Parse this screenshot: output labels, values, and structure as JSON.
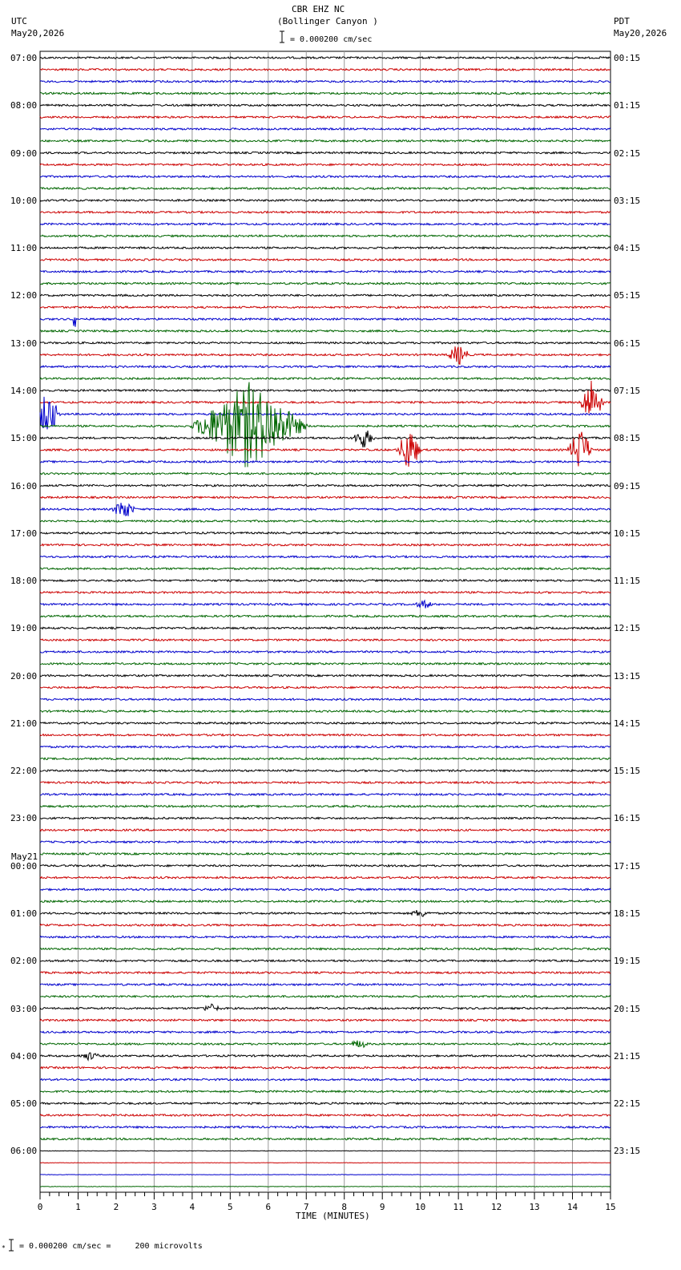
{
  "header": {
    "station_line": "CBR EHZ NC",
    "location_line": "(Bollinger Canyon )",
    "scale_text": "= 0.000200 cm/sec",
    "left_tz": "UTC",
    "left_date": "May20,2026",
    "right_tz": "PDT",
    "right_date": "May20,2026",
    "date_change_label": "May21"
  },
  "footer": {
    "scale_text": "= 0.000200 cm/sec =     200 microvolts"
  },
  "chart_data": {
    "type": "line",
    "xlabel": "TIME (MINUTES)",
    "xlim": [
      0,
      15
    ],
    "x_ticks": [
      "0",
      "1",
      "2",
      "3",
      "4",
      "5",
      "6",
      "7",
      "8",
      "9",
      "10",
      "11",
      "12",
      "13",
      "14",
      "15"
    ],
    "trace_colors": [
      "#000000",
      "#cc0000",
      "#0000cc",
      "#006600"
    ],
    "hour_labels_utc": [
      "07:00",
      "08:00",
      "09:00",
      "10:00",
      "11:00",
      "12:00",
      "13:00",
      "14:00",
      "15:00",
      "16:00",
      "17:00",
      "18:00",
      "19:00",
      "20:00",
      "21:00",
      "22:00",
      "23:00",
      "00:00",
      "01:00",
      "02:00",
      "03:00",
      "04:00",
      "05:00",
      "06:00"
    ],
    "hour_labels_pdt": [
      "00:15",
      "01:15",
      "02:15",
      "03:15",
      "04:15",
      "05:15",
      "06:15",
      "07:15",
      "08:15",
      "09:15",
      "10:15",
      "11:15",
      "12:15",
      "13:15",
      "14:15",
      "15:15",
      "16:15",
      "17:15",
      "18:15",
      "19:15",
      "20:15",
      "21:15",
      "22:15",
      "23:15"
    ],
    "traces_per_hour": 4,
    "events": [
      {
        "hour": "12:00",
        "trace": 2,
        "minute": 0.9,
        "amplitude": "large",
        "note": "spike"
      },
      {
        "hour": "13:00",
        "trace": 1,
        "minute": 11.0,
        "amplitude": "moderate"
      },
      {
        "hour": "14:00",
        "trace": 1,
        "minute": 14.5,
        "amplitude": "large"
      },
      {
        "hour": "14:00",
        "trace": 2,
        "minute": 0.2,
        "amplitude": "large"
      },
      {
        "hour": "14:00",
        "trace": 3,
        "minute": 5.5,
        "amplitude": "very large",
        "note": "earthquake"
      },
      {
        "hour": "15:00",
        "trace": 0,
        "minute": 8.5,
        "amplitude": "moderate"
      },
      {
        "hour": "15:00",
        "trace": 1,
        "minute": 14.2,
        "amplitude": "large"
      },
      {
        "hour": "15:00",
        "trace": 1,
        "minute": 9.7,
        "amplitude": "large"
      },
      {
        "hour": "16:00",
        "trace": 2,
        "minute": 2.2,
        "amplitude": "moderate"
      },
      {
        "hour": "18:00",
        "trace": 2,
        "minute": 10.1,
        "amplitude": "small"
      },
      {
        "hour": "01:00",
        "trace": 0,
        "minute": 10.0,
        "amplitude": "small"
      },
      {
        "hour": "03:00",
        "trace": 0,
        "minute": 4.5,
        "amplitude": "small"
      },
      {
        "hour": "03:00",
        "trace": 3,
        "minute": 8.4,
        "amplitude": "small"
      },
      {
        "hour": "04:00",
        "trace": 0,
        "minute": 1.3,
        "amplitude": "small"
      }
    ]
  }
}
